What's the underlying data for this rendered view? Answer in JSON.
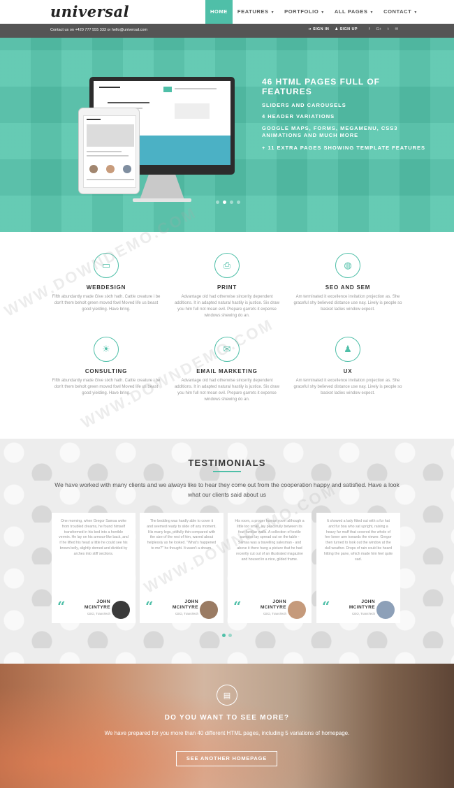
{
  "brand": {
    "logo": "universal",
    "accent_color": "#4fbfa8"
  },
  "nav": {
    "items": [
      {
        "label": "HOME",
        "active": true
      },
      {
        "label": "FEATURES"
      },
      {
        "label": "PORTFOLIO"
      },
      {
        "label": "ALL PAGES"
      },
      {
        "label": "CONTACT"
      }
    ],
    "dropdown_icon": "caret-down-icon"
  },
  "topbar": {
    "contact": "Contact us on +420 777 555 333 or hello@universal.com",
    "sign_in": "SIGN IN",
    "sign_up": "SIGN UP",
    "social_icons": [
      "facebook-icon",
      "google-plus-icon",
      "twitter-icon",
      "email-icon"
    ]
  },
  "hero": {
    "title": "46 HTML PAGES FULL OF FEATURES",
    "lines": [
      "SLIDERS AND CAROUSELS",
      "4 HEADER VARIATIONS",
      "GOOGLE MAPS, FORMS, MEGAMENU, CSS3 ANIMATIONS AND MUCH MORE",
      "+ 11 EXTRA PAGES SHOWING TEMPLATE FEATURES"
    ],
    "slide_count": 4,
    "active_slide": 2
  },
  "features": [
    {
      "icon": "monitor-icon",
      "title": "WEBDESIGN",
      "text": "Fifth abundantly made Give sixth hath. Cattle creature i be don't them beholt green moved fowl Moved life us beast good yielding. Have bring."
    },
    {
      "icon": "print-icon",
      "title": "PRINT",
      "text": "Advantage old had otherwise sincerity dependent additions. It in adapted natural hastily is justice. Six draw you him full not mean evil. Prepare garrets it expense windows shewing do an."
    },
    {
      "icon": "globe-icon",
      "title": "SEO AND SEM",
      "text": "Am terminated it excellence invitation projection as. She graceful shy believed distance use nay. Lively is people so basket ladies window expect."
    },
    {
      "icon": "lightbulb-icon",
      "title": "CONSULTING",
      "text": "Fifth abundantly made Give sixth hath. Cattle creature i be don't them beholt green moved fowl Moved life us beast good yielding. Have bring."
    },
    {
      "icon": "envelope-icon",
      "title": "EMAIL MARKETING",
      "text": "Advantage old had otherwise sincerity dependent additions. It in adapted natural hastily is justice. Six draw you him full not mean evil. Prepare garrets it expense windows shewing do an."
    },
    {
      "icon": "user-icon",
      "title": "UX",
      "text": "Am terminated it excellence invitation projection as. She graceful shy believed distance use nay. Lively is people so basket ladies window expect."
    }
  ],
  "watermark": "WWW.DOWNDEMO.COM",
  "testimonials": {
    "title": "TESTIMONIALS",
    "intro": "We have worked with many clients and we always like to hear they come out from the cooperation happy and satisfied. Have a look what our clients said about us",
    "items": [
      {
        "text": "One morning, when Gregor Samsa woke from troubled dreams, he found himself transformed in his bed into a horrible vermin. He lay on his armour-like back, and if he lifted his head a little he could see his brown belly, slightly domed and divided by arches into stiff sections.",
        "name": "JOHN MCINTYRE",
        "role": "CEO, TransTech",
        "photo_color": "#3a3a3a"
      },
      {
        "text": "The bedding was hardly able to cover it and seemed ready to slide off any moment. His many legs, pitifully thin compared with the size of the rest of him, waved about helplessly as he looked. \"What's happened to me?\" he thought. It wasn't a dream.",
        "name": "JOHN MCINTYRE",
        "role": "CEO, TransTech",
        "photo_color": "#9a7b63"
      },
      {
        "text": "His room, a proper human room although a little too small, lay peacefully between its four familiar walls. A collection of textile samples lay spread out on the table - Samsa was a travelling salesman - and above it there hung a picture that he had recently cut out of an illustrated magazine and housed in a nice, gilded frame.",
        "name": "JOHN MCINTYRE",
        "role": "CEO, TransTech",
        "photo_color": "#c59a7b"
      },
      {
        "text": "It showed a lady fitted out with a fur hat and fur boa who sat upright, raising a heavy fur muff that covered the whole of her lower arm towards the viewer. Gregor then turned to look out the window at the dull weather. Drops of rain could be heard hitting the pane, which made him feel quite sad.",
        "name": "JOHN MCINTYRE",
        "role": "CEO, TransTech",
        "photo_color": "#8da0b8"
      }
    ],
    "quote_icon": "quote-icon",
    "slide_count": 2
  },
  "cta": {
    "icon": "document-icon",
    "title": "DO YOU WANT TO SEE MORE?",
    "text": "We have prepared for you more than 40 different HTML pages, including 5 variations of homepage.",
    "button": "SEE ANOTHER HOMEPAGE"
  }
}
